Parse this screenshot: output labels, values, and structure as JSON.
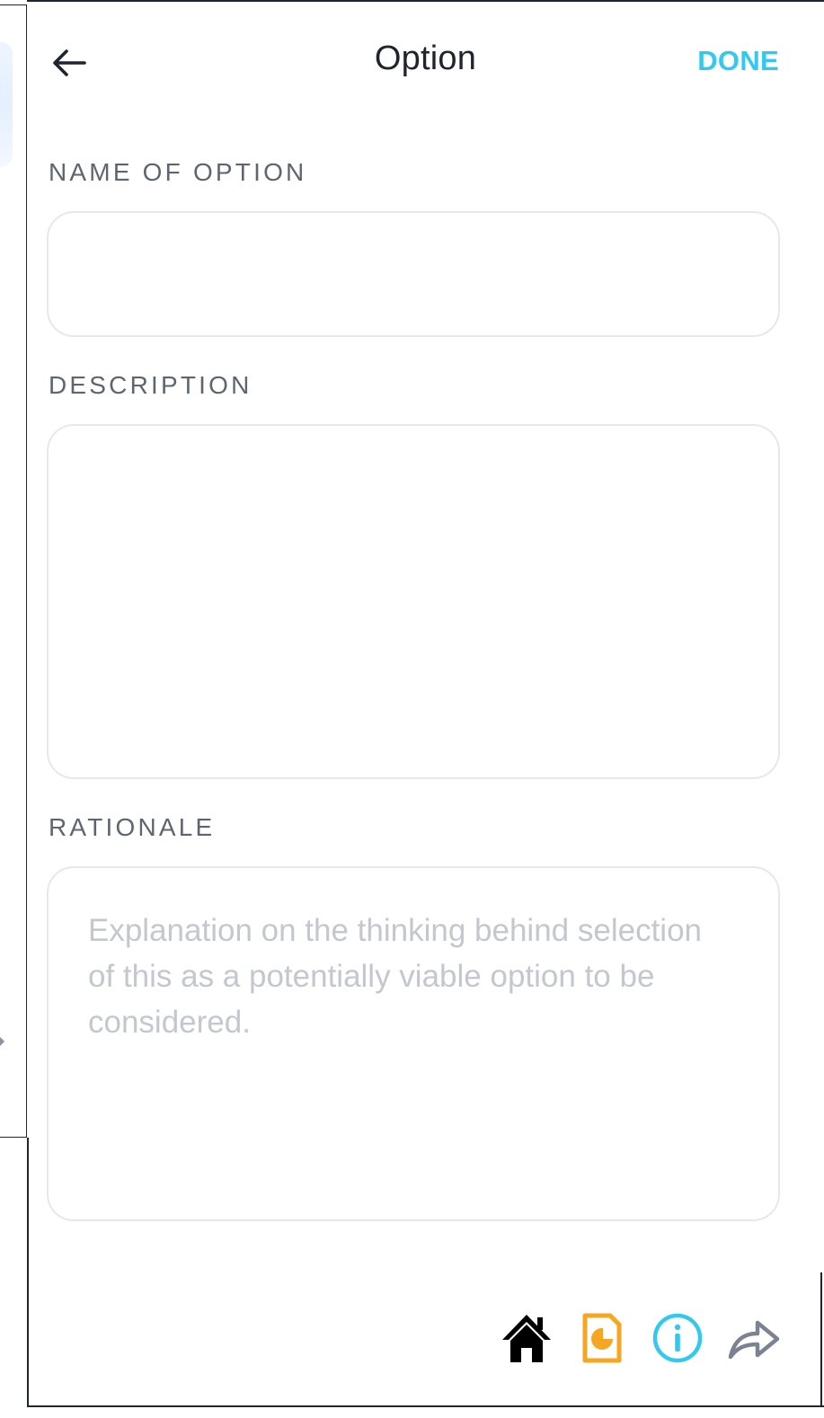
{
  "header": {
    "title": "Option",
    "done_label": "DONE"
  },
  "fields": {
    "name": {
      "label": "NAME OF OPTION",
      "value": "",
      "placeholder": ""
    },
    "description": {
      "label": "DESCRIPTION",
      "value": "",
      "placeholder": ""
    },
    "rationale": {
      "label": "RATIONALE",
      "value": "",
      "placeholder": "Explanation on the thinking behind selection of this as a potentially viable option to be considered."
    }
  },
  "bottom_bar": {
    "icons": [
      "home-icon",
      "report-icon",
      "info-icon",
      "share-icon"
    ]
  },
  "colors": {
    "accent": "#33c9ee",
    "title": "#1e2530",
    "label": "#5d6670",
    "placeholder": "#c3c7cf",
    "border": "#e6e8ec",
    "report_icon": "#f6a623",
    "info_icon": "#33c9ee",
    "share_icon": "#7b8391"
  }
}
